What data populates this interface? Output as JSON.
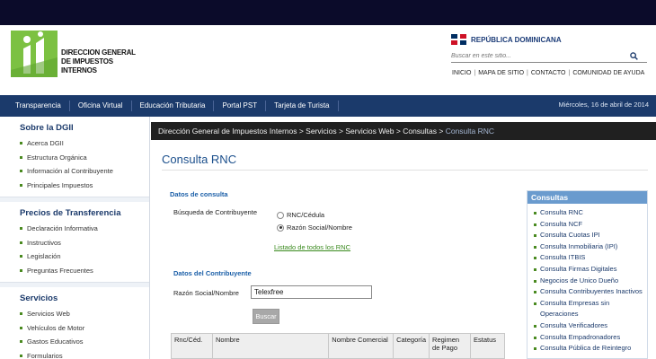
{
  "header": {
    "logo_lines": [
      "DIRECCION GENERAL",
      "DE IMPUESTOS",
      "INTERNOS"
    ],
    "country_label": "REPÚBLICA DOMINICANA",
    "search_placeholder": "Buscar en este sitio...",
    "top_links": [
      "INICIO",
      "MAPA DE SITIO",
      "CONTACTO",
      "COMUNIDAD DE AYUDA"
    ]
  },
  "nav": {
    "items": [
      "Transparencia",
      "Oficina Virtual",
      "Educación Tributaria",
      "Portal PST",
      "Tarjeta de Turista"
    ],
    "date": "Miércoles, 16 de abril de 2014"
  },
  "sidebar": {
    "sections": [
      {
        "title": "Sobre la DGII",
        "items": [
          "Acerca DGII",
          "Estructura Orgánica",
          "Información al Contribuyente",
          "Principales Impuestos"
        ]
      },
      {
        "title": "Precios de Transferencia",
        "items": [
          "Declaración Informativa",
          "Instructivos",
          "Legislación",
          "Preguntas Frecuentes"
        ]
      },
      {
        "title": "Servicios",
        "items": [
          "Servicios Web",
          "Vehículos de Motor",
          "Gastos Educativos",
          "Formularios"
        ]
      }
    ]
  },
  "breadcrumb": {
    "trail": "Dirección General de Impuestos Internos > Servicios > Servicios Web > Consultas > ",
    "current": "Consulta RNC"
  },
  "main": {
    "title": "Consulta RNC",
    "datos_consulta": "Datos de consulta",
    "busqueda_label": "Búsqueda de Contribuyente",
    "radio_rnc": "RNC/Cédula",
    "radio_razon": "Razón Social/Nombre",
    "listado_link": "Listado de todos los RNC",
    "datos_contribuyente": "Datos del Contribuyente",
    "razon_label": "Razón Social/Nombre",
    "razon_value": "Telexfree",
    "buscar_label": "Buscar",
    "table_headers": [
      "Rnc/Céd.",
      "Nombre",
      "Nombre Comercial",
      "Categoría",
      "Regimen de Pago",
      "Estatus"
    ]
  },
  "consultas": {
    "title": "Consultas",
    "items": [
      "Consulta RNC",
      "Consulta NCF",
      "Consulta Cuotas IPI",
      "Consulta Inmobiliaria (IPI)",
      "Consulta ITBIS",
      "Consulta Firmas Digitales",
      "Negocios de Unico Dueño",
      "Consulta Contribuyentes Inactivos",
      "Consulta Empresas sin Operaciones",
      "Consulta Verificadores",
      "Consulta Empadronadores",
      "Consulta Pública de Reintegro"
    ]
  },
  "colors": {
    "navbar": "#1b3a6b",
    "logo_green": "#7cc142",
    "accent_blue": "#1b5fa8",
    "link_green": "#3a8a1e"
  }
}
